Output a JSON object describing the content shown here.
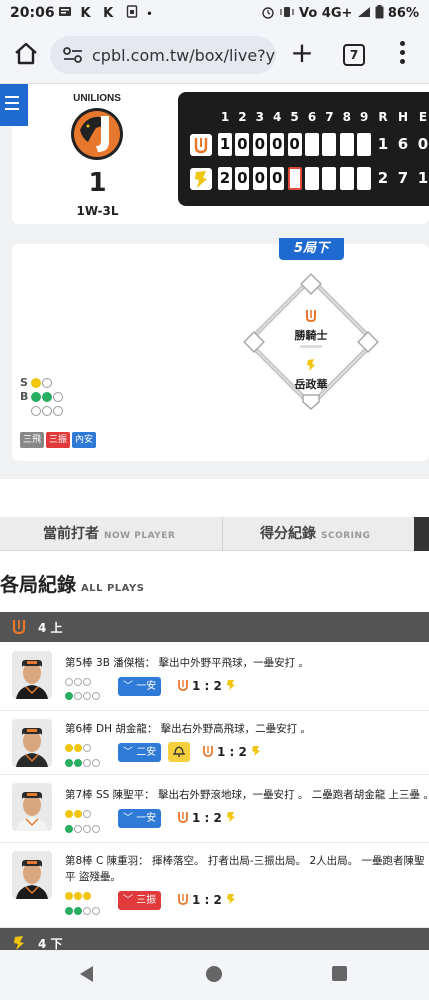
{
  "status_bar": {
    "time": "20:06",
    "left_icons": "K K",
    "right_text": "Vo̅ 4G+ .▎ 86%",
    "battery": "86%"
  },
  "browser": {
    "url": "cpbl.com.tw/box/live?ye",
    "tab_count": "7",
    "plus": "+"
  },
  "home_team": {
    "name": "UNILIONS",
    "score": "1",
    "record": "1W-3L",
    "accent": "#e8772e"
  },
  "scoreboard": {
    "innings": [
      "1",
      "2",
      "3",
      "4",
      "5",
      "6",
      "7",
      "8",
      "9"
    ],
    "rhe_headers": [
      "R",
      "H",
      "E"
    ],
    "rows": [
      {
        "team": "uni",
        "cells": [
          "1",
          "0",
          "0",
          "0",
          "0",
          "",
          "",
          "",
          ""
        ],
        "totals": [
          "1",
          "6",
          "0"
        ]
      },
      {
        "team": "bra",
        "cells": [
          "2",
          "0",
          "0",
          "0",
          "",
          "",
          "",
          "",
          ""
        ],
        "totals": [
          "2",
          "7",
          "1"
        ]
      }
    ]
  },
  "game_state": {
    "inning_tag": "5局下",
    "batter": "勝騎士",
    "pitcher": "岳政華",
    "count": {
      "s_label": "S",
      "b_label": "B"
    },
    "tags": [
      "三飛",
      "三振",
      "內安"
    ]
  },
  "tabs": {
    "current": {
      "label": "當前打者",
      "sub": "NOW PLAYER"
    },
    "scoring": {
      "label": "得分紀錄",
      "sub": "SCORING"
    }
  },
  "section": {
    "title": "各局紀錄",
    "sub": "ALL PLAYS"
  },
  "inning_bars": [
    {
      "label": "4 上"
    },
    {
      "label": "4 下"
    }
  ],
  "plays": [
    {
      "desc": "第5棒 3B 潘傑楷： 擊出中外野平飛球，一壘安打 。",
      "result": "一安",
      "score": "1 : 2"
    },
    {
      "desc": "第6棒 DH 胡金龍： 擊出右外野高飛球，二壘安打 。",
      "result": "二安",
      "score": "1 : 2"
    },
    {
      "desc": "第7棒 SS 陳聖平： 擊出右外野滾地球，一壘安打 。 二壘跑者胡金龍 上三壘 。",
      "result": "一安",
      "score": "1 : 2"
    },
    {
      "desc": "第8棒 C 陳重羽： 揮棒落空。 打者出局-三振出局。 2人出局。 一壘跑者陳聖平 盜殘壘。",
      "result": "三振",
      "score": "1 : 2"
    }
  ],
  "colors": {
    "blue": "#1e6ad0",
    "uni_orange": "#e8772e",
    "brother_yellow": "#f1c40f",
    "red": "#e03a3a"
  }
}
